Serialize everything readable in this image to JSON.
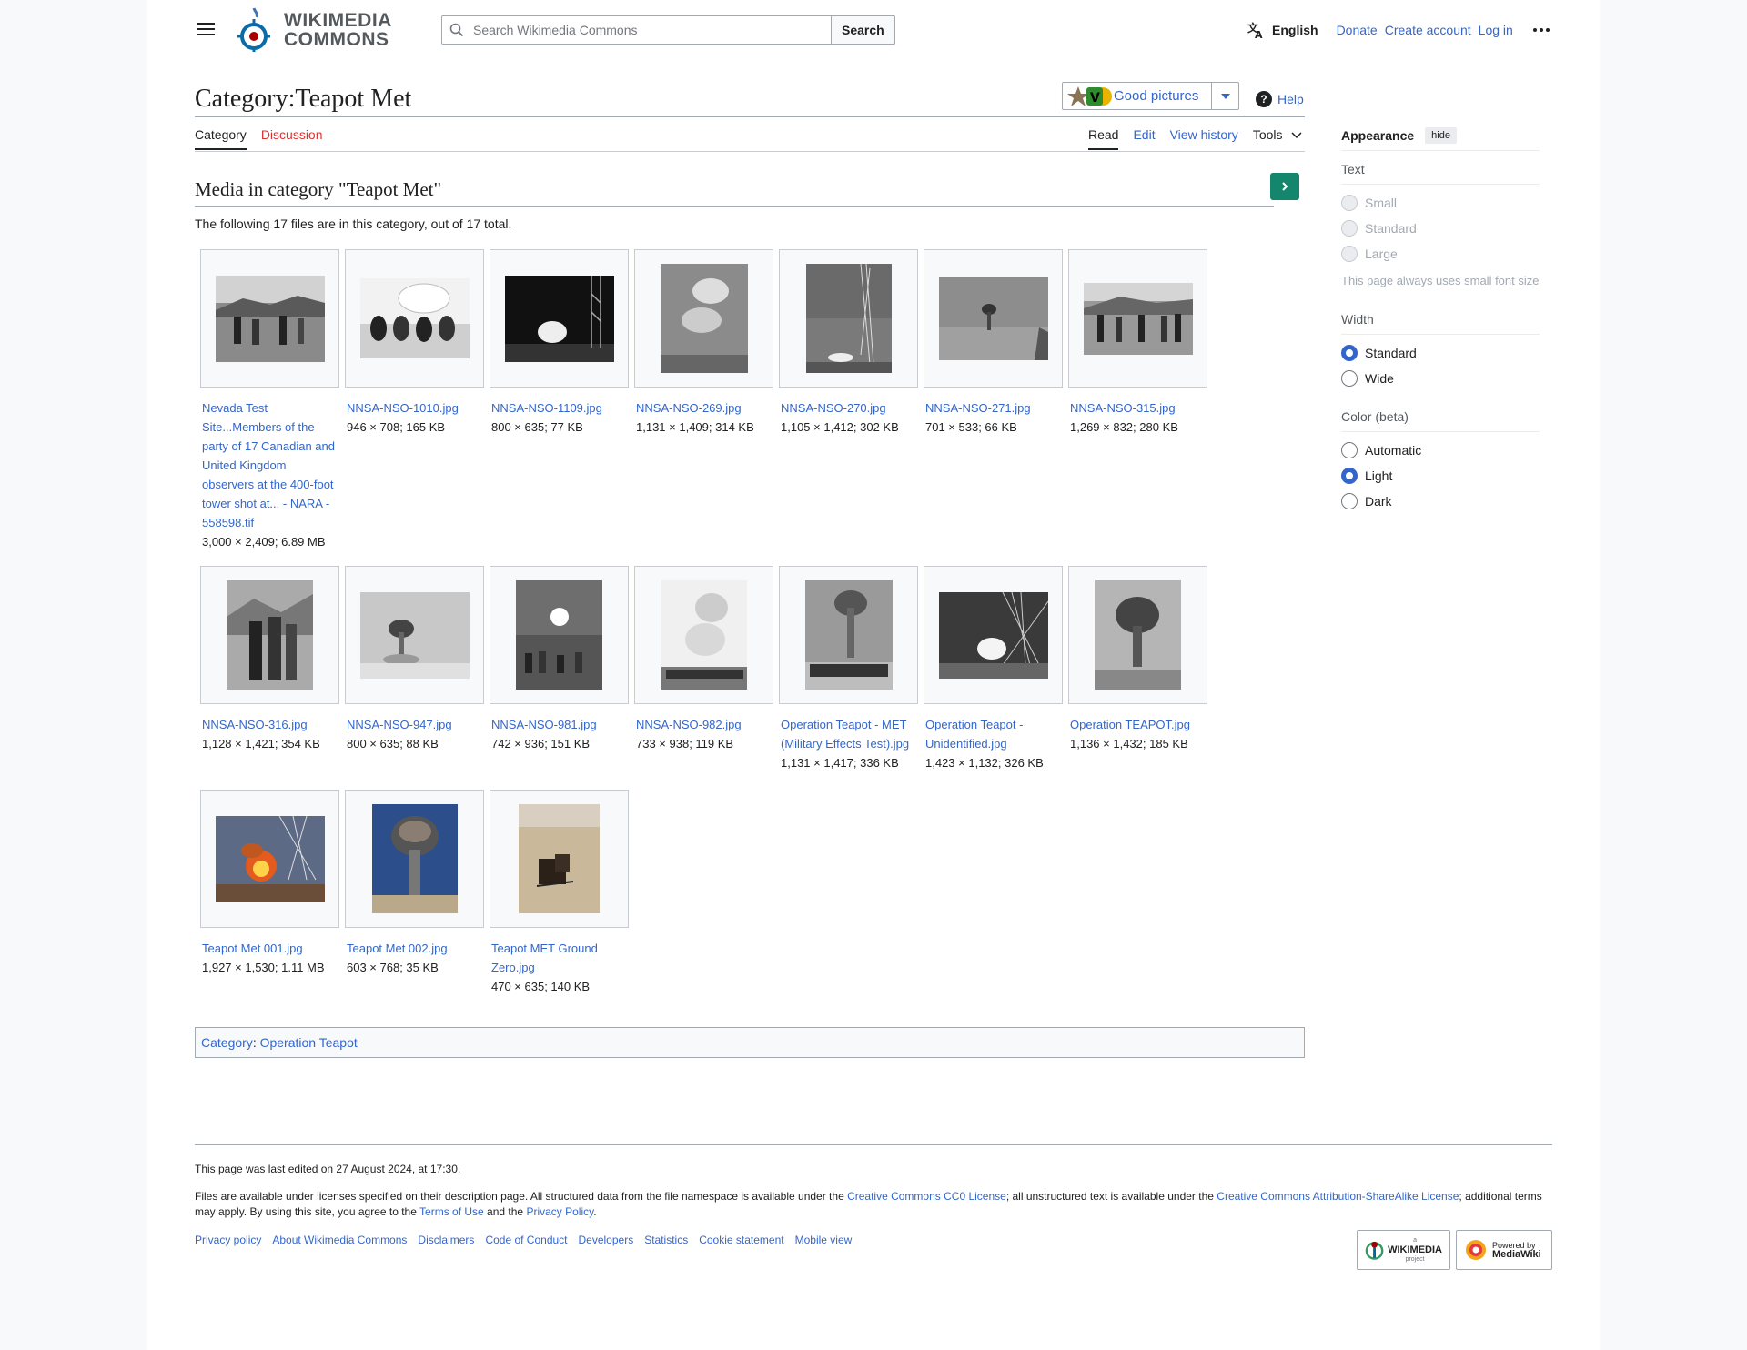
{
  "header": {
    "logo_line1": "WIKIMEDIA",
    "logo_line2": "COMMONS",
    "search_placeholder": "Search Wikimedia Commons",
    "search_button": "Search",
    "language": "English",
    "donate": "Donate",
    "create_account": "Create account",
    "log_in": "Log in"
  },
  "title": {
    "ns": "Category:",
    "name": "Teapot Met"
  },
  "good_pictures": "Good pictures",
  "help": "Help",
  "tabs": {
    "category": "Category",
    "discussion": "Discussion",
    "read": "Read",
    "edit": "Edit",
    "view_history": "View history",
    "tools": "Tools"
  },
  "section_title": "Media in category \"Teapot Met\"",
  "count_text": "The following 17 files are in this category, out of 17 total.",
  "files": [
    {
      "name": "Nevada Test Site...Members of the party of 17 Canadian and United Kingdom observers at the 400-foot tower shot at... - NARA - 558598.tif",
      "meta": "3,000 × 2,409; 6.89 MB"
    },
    {
      "name": "NNSA-NSO-1010.jpg",
      "meta": "946 × 708; 165 KB"
    },
    {
      "name": "NNSA-NSO-1109.jpg",
      "meta": "800 × 635; 77 KB"
    },
    {
      "name": "NNSA-NSO-269.jpg",
      "meta": "1,131 × 1,409; 314 KB"
    },
    {
      "name": "NNSA-NSO-270.jpg",
      "meta": "1,105 × 1,412; 302 KB"
    },
    {
      "name": "NNSA-NSO-271.jpg",
      "meta": "701 × 533; 66 KB"
    },
    {
      "name": "NNSA-NSO-315.jpg",
      "meta": "1,269 × 832; 280 KB"
    },
    {
      "name": "NNSA-NSO-316.jpg",
      "meta": "1,128 × 1,421; 354 KB"
    },
    {
      "name": "NNSA-NSO-947.jpg",
      "meta": "800 × 635; 88 KB"
    },
    {
      "name": "NNSA-NSO-981.jpg",
      "meta": "742 × 936; 151 KB"
    },
    {
      "name": "NNSA-NSO-982.jpg",
      "meta": "733 × 938; 119 KB"
    },
    {
      "name": "Operation Teapot - MET (Military Effects Test).jpg",
      "meta": "1,131 × 1,417; 336 KB"
    },
    {
      "name": "Operation Teapot - Unidentified.jpg",
      "meta": "1,423 × 1,132; 326 KB"
    },
    {
      "name": "Operation TEAPOT.jpg",
      "meta": "1,136 × 1,432; 185 KB"
    },
    {
      "name": "Teapot Met 001.jpg",
      "meta": "1,927 × 1,530; 1.11 MB"
    },
    {
      "name": "Teapot Met 002.jpg",
      "meta": "603 × 768; 35 KB"
    },
    {
      "name": "Teapot MET Ground Zero.jpg",
      "meta": "470 × 635; 140 KB"
    }
  ],
  "catlinks": {
    "label": "Category",
    "sep": ": ",
    "link": "Operation Teapot"
  },
  "appearance": {
    "title": "Appearance",
    "hide": "hide",
    "text_group": "Text",
    "text_options": [
      "Small",
      "Standard",
      "Large"
    ],
    "text_note": "This page always uses small font size",
    "width_group": "Width",
    "width_options": [
      "Standard",
      "Wide"
    ],
    "color_group": "Color (beta)",
    "color_options": [
      "Automatic",
      "Light",
      "Dark"
    ]
  },
  "footer": {
    "last_edited": "This page was last edited on 27 August 2024, at 17:30.",
    "lic_1": "Files are available under licenses specified on their description page. All structured data from the file namespace is available under the ",
    "lic_link1": "Creative Commons CC0 License",
    "lic_2": "; all unstructured text is available under the ",
    "lic_link2": "Creative Commons Attribution-ShareAlike License",
    "lic_3": "; additional terms may apply. By using this site, you agree to the ",
    "lic_link3": "Terms of Use",
    "lic_4": " and the ",
    "lic_link4": "Privacy Policy",
    "lic_5": ".",
    "links": [
      "Privacy policy",
      "About Wikimedia Commons",
      "Disclaimers",
      "Code of Conduct",
      "Developers",
      "Statistics",
      "Cookie statement",
      "Mobile view"
    ],
    "badge1_small": "a",
    "badge1_big": "WIKIMEDIA",
    "badge1_sub": "project",
    "badge2_small": "Powered by",
    "badge2_big": "MediaWiki"
  }
}
